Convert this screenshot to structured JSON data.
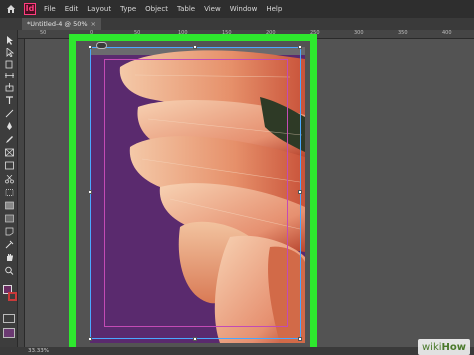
{
  "app": {
    "logo_text": "Id",
    "accent_color": "#ff3d7f"
  },
  "menu": [
    "File",
    "Edit",
    "Layout",
    "Type",
    "Object",
    "Table",
    "View",
    "Window",
    "Help"
  ],
  "document_tab": {
    "label": "*Untitled-4 @ 50%",
    "close": "×"
  },
  "ruler": {
    "top_ticks": [
      "50",
      "0",
      "50",
      "100",
      "150",
      "200",
      "250",
      "300",
      "350",
      "400"
    ]
  },
  "status": {
    "zoom": "33.33%"
  },
  "canvas": {
    "highlight_color": "#2ee82e",
    "background_color": "#5a2a6e"
  },
  "watermark": {
    "part1": "wiki",
    "part2": "How"
  }
}
